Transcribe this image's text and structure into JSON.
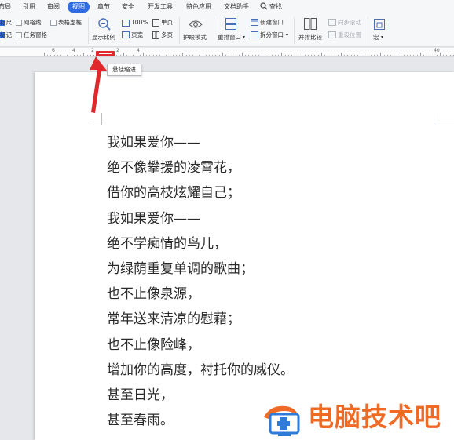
{
  "menu": {
    "tabs": [
      {
        "label": "布局",
        "active": false
      },
      {
        "label": "引用",
        "active": false
      },
      {
        "label": "审阅",
        "active": false
      },
      {
        "label": "视图",
        "active": true
      },
      {
        "label": "章节",
        "active": false
      },
      {
        "label": "安全",
        "active": false
      },
      {
        "label": "开发工具",
        "active": false
      },
      {
        "label": "特色应用",
        "active": false
      },
      {
        "label": "文档助手",
        "active": false
      },
      {
        "label": "查找",
        "active": false
      }
    ]
  },
  "ribbon": {
    "ruler_label": "标尺",
    "mark_label": "标记",
    "gridlines_label": "网格线",
    "taskpane_label": "任务窗格",
    "table_gridlines_label": "表格虚框",
    "zoom_label": "显示比例",
    "zoom_value": "100%",
    "page_width_label": "页宽",
    "single_page_label": "单页",
    "multi_page_label": "多页",
    "eye_mode_label": "护眼模式",
    "rearrange_label": "重排窗口",
    "new_window_label": "新建窗口",
    "split_window_label": "拆分窗口",
    "side_by_side_label": "并排比较",
    "sync_scroll_label": "同步滚动",
    "reset_position_label": "重设位置",
    "macro_label": "宏"
  },
  "tooltip": {
    "text": "悬挂缩进"
  },
  "ruler": {
    "numbers": [
      "6",
      "4",
      "2",
      "2",
      "4",
      "40"
    ]
  },
  "document": {
    "lines": [
      "我如果爱你——",
      "绝不像攀援的凌霄花，",
      "借你的高枝炫耀自己；",
      "我如果爱你——",
      "绝不学痴情的鸟儿，",
      "为绿荫重复单调的歌曲；",
      "也不止像泉源，",
      "常年送来清凉的慰藉；",
      "也不止像险峰，",
      "增加你的高度，衬托你的威仪。",
      "甚至日光，",
      "甚至春雨。"
    ]
  },
  "watermark": {
    "text": "电脑技术吧"
  },
  "colors": {
    "accent": "#2f6ce2",
    "marker": "#e0282c",
    "arrow": "#e0282c",
    "watermark": "#ee6a25"
  }
}
